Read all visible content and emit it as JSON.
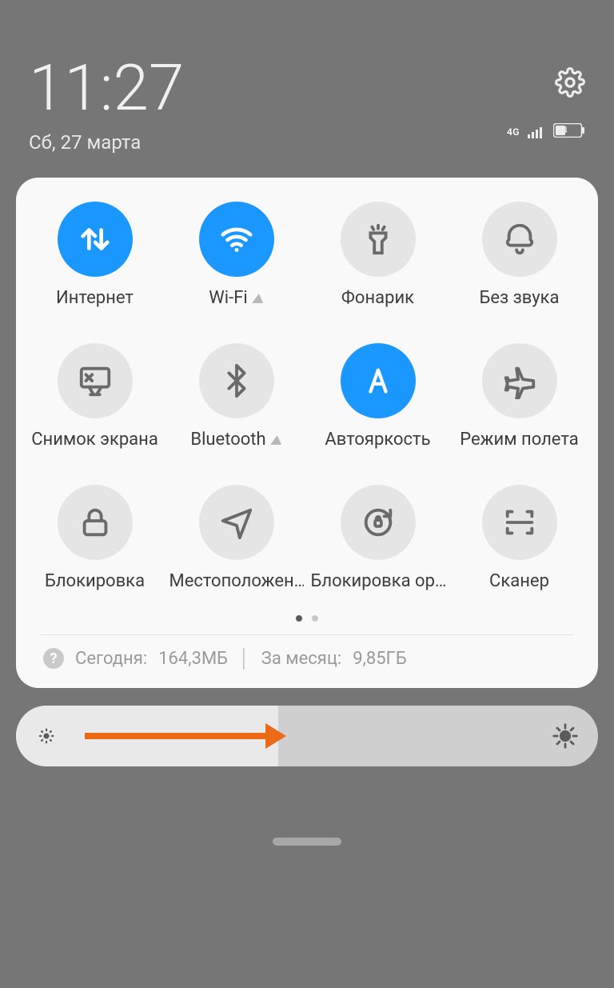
{
  "header": {
    "time": "11:27",
    "date": "Сб, 27 марта",
    "network_label": "4G",
    "battery_percent": "38"
  },
  "tiles": [
    {
      "label": "Интернет",
      "icon": "data-arrows",
      "active": true,
      "expandable": false
    },
    {
      "label": "Wi-Fi",
      "icon": "wifi",
      "active": true,
      "expandable": true
    },
    {
      "label": "Фонарик",
      "icon": "flashlight",
      "active": false,
      "expandable": false
    },
    {
      "label": "Без звука",
      "icon": "bell",
      "active": false,
      "expandable": false
    },
    {
      "label": "Снимок экрана",
      "icon": "screenshot",
      "active": false,
      "expandable": false
    },
    {
      "label": "Bluetooth",
      "icon": "bluetooth",
      "active": false,
      "expandable": true
    },
    {
      "label": "Автояркость",
      "icon": "auto-bright",
      "active": true,
      "expandable": false
    },
    {
      "label": "Режим полета",
      "icon": "airplane",
      "active": false,
      "expandable": false
    },
    {
      "label": "Блокировка",
      "icon": "lock",
      "active": false,
      "expandable": false
    },
    {
      "label": "Местоположен…",
      "icon": "location",
      "active": false,
      "expandable": false
    },
    {
      "label": "Блокировка ор…",
      "icon": "rotation-lock",
      "active": false,
      "expandable": false
    },
    {
      "label": "Сканер",
      "icon": "scanner",
      "active": false,
      "expandable": false
    }
  ],
  "pager": {
    "current": 0,
    "count": 2
  },
  "usage": {
    "today_label": "Сегодня:",
    "today_value": "164,3МБ",
    "month_label": "За месяц:",
    "month_value": "9,85ГБ"
  },
  "brightness": {
    "percent": 45
  },
  "colors": {
    "accent": "#1a98ff",
    "arrow": "#ec6a17"
  }
}
